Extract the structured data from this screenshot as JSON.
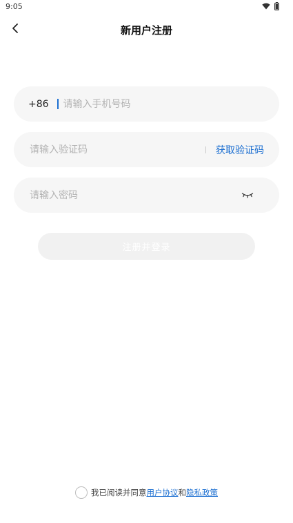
{
  "status_bar": {
    "time": "9:05",
    "icons": [
      "wifi-icon",
      "battery-icon"
    ]
  },
  "header": {
    "title": "新用户注册",
    "back_icon": "chevron-left-icon"
  },
  "form": {
    "phone": {
      "country_code": "+86",
      "value": "",
      "placeholder": "请输入手机号码"
    },
    "code": {
      "value": "",
      "placeholder": "请输入验证码",
      "get_code_label": "获取验证码"
    },
    "password": {
      "value": "",
      "placeholder": "请输入密码",
      "toggle_icon": "eye-closed-icon"
    },
    "submit_label": "注册并登录"
  },
  "agreement": {
    "prefix": "我已阅读并同意",
    "user_agreement": "用户协议",
    "conjunction": "和",
    "privacy_policy": "隐私政策",
    "checked": false
  },
  "colors": {
    "accent": "#1c6fd1",
    "field_bg": "#f6f6f6",
    "button_disabled_bg": "#f1f1f1",
    "placeholder": "#b3b3b3"
  }
}
